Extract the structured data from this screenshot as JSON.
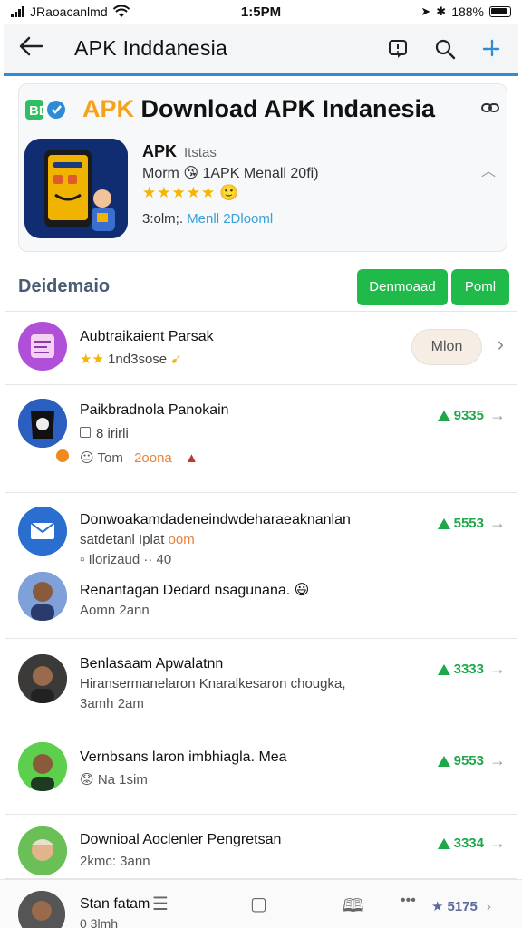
{
  "status": {
    "carrier": "JRaoacanlmd",
    "time": "1:5PM",
    "battery": "188%"
  },
  "appbar": {
    "title": "APK  Inddanesia"
  },
  "header_card": {
    "brand_text": "BD",
    "title_prefix": "APK",
    "title_rest": " Download APK Indanesia",
    "app_name": "APK",
    "app_tag": "Itstas",
    "app_sub": "Morm 😘 1APK Menall 20fi)",
    "stars": "★★★★★",
    "meta_prefix": "3:olm;. ",
    "meta_highlight": "Menll 2Dlooml"
  },
  "section": {
    "title": "Deidemaio",
    "download_label": "Denmoaad",
    "primary_label": "Poml"
  },
  "rows": [
    {
      "title": "Aubtraikaient Parsak",
      "sub_stars": "★★",
      "sub_text": " 1nd3sose",
      "pill": "Mlon"
    },
    {
      "title": "Paikbradnola Panokain",
      "line2": "8 irirli",
      "line3": "Tom",
      "line3_highlight": "2oona",
      "score": "9335"
    },
    {
      "title": "Donwoakamdadeneindwdeharaeaknanlan",
      "line2_a": "satdetanl Iplat",
      "line2_b": " oom",
      "line3": "Ilorizaud ·· 40",
      "score": "5553"
    },
    {
      "title": "Renantagan Dedard nsagunana. 😃",
      "line2": "Aomn  2ann"
    },
    {
      "title": "Benlasaam Apwalatnn",
      "line2": "Hiransermanelaron Knaralkesaron chougka,",
      "line3": "3amh  2am",
      "score": "3333"
    },
    {
      "title": "Vernbsans laron imbhiaglа. Mea",
      "line2": "Na  1sim",
      "score": "9553"
    },
    {
      "title": "Downioal Aoclenler Pengretsan",
      "line2": "2kmc: 3ann",
      "score": "3334"
    },
    {
      "title": "Stan fatam",
      "line2": "0 3lmh",
      "score": "5175"
    }
  ],
  "colors": {
    "accent_blue": "#2d8bd8",
    "green": "#1fba4a",
    "orange": "#f5a21a"
  }
}
